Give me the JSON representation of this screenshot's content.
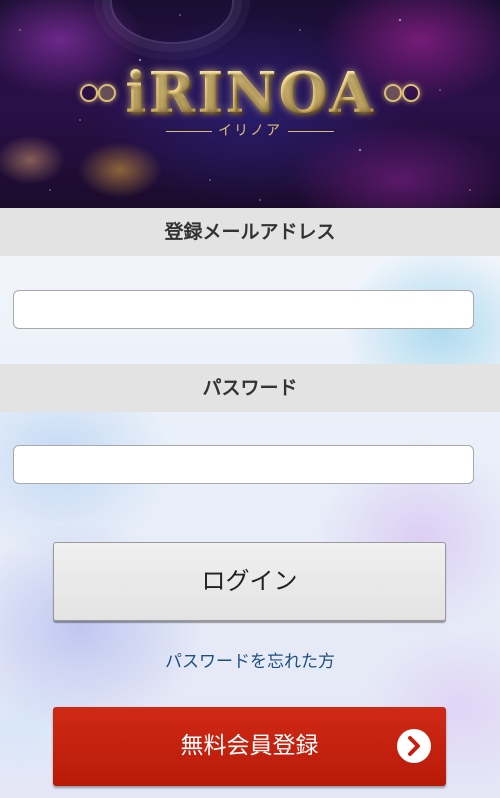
{
  "header": {
    "logo_text": "iRINOA",
    "logo_kana": "イリノア"
  },
  "form": {
    "email_label": "登録メールアドレス",
    "email_value": "",
    "password_label": "パスワード",
    "password_value": ""
  },
  "actions": {
    "login_label": "ログイン",
    "forgot_password_label": "パスワードを忘れた方",
    "register_label": "無料会員登録"
  },
  "icons": {
    "register_arrow": "chevron-right-circle-icon"
  },
  "colors": {
    "register_button": "#c4200d",
    "link": "#1f4f7f",
    "section_header_bg": "#e3e3e3"
  }
}
